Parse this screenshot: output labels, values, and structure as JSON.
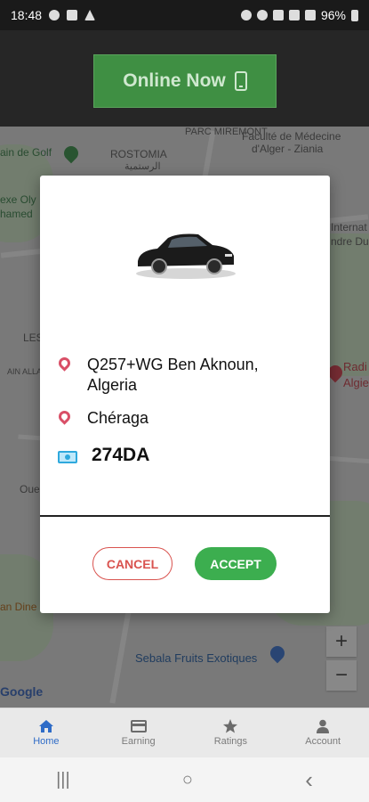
{
  "status_bar": {
    "time": "18:48",
    "battery": "96%"
  },
  "top": {
    "online_button_label": "Online Now"
  },
  "map": {
    "labels": {
      "golf": "ain de Golf",
      "parc": "PARC MIREMONT",
      "faculte_1": "Faculté de Médecine",
      "faculte_2": "d'Alger - Ziania",
      "rostomia": "ROSTOMIA",
      "rostomia_ar": "الرستمية",
      "complexe_1": "exe Oly",
      "complexe_2": "hamed",
      "intern_1": "Internat",
      "intern_2": "ndre Du",
      "les": "LES",
      "ain_allah": "AIN ALLAH",
      "radi_1": "Radi",
      "radi_2": "Algie",
      "oue": "Oue",
      "dine": "an Dine",
      "sebala": "Sebala Fruits Exotiques",
      "google": "Google"
    },
    "zoom_in": "+",
    "zoom_out": "−"
  },
  "dialog": {
    "pickup": "Q257+WG Ben Aknoun, Algeria",
    "dropoff": "Chéraga",
    "price": "274DA",
    "cancel_label": "CANCEL",
    "accept_label": "ACCEPT",
    "colors": {
      "accept": "#3cae4f",
      "cancel": "#d9534f",
      "pin": "#d94f67",
      "cash": "#2fa9dd"
    }
  },
  "bottom_nav": {
    "items": [
      {
        "label": "Home",
        "icon": "home-icon",
        "active": true
      },
      {
        "label": "Earning",
        "icon": "card-icon",
        "active": false
      },
      {
        "label": "Ratings",
        "icon": "star-icon",
        "active": false
      },
      {
        "label": "Account",
        "icon": "person-icon",
        "active": false
      }
    ]
  },
  "system_nav": {
    "recents": "|||",
    "home": "○",
    "back": "‹"
  }
}
